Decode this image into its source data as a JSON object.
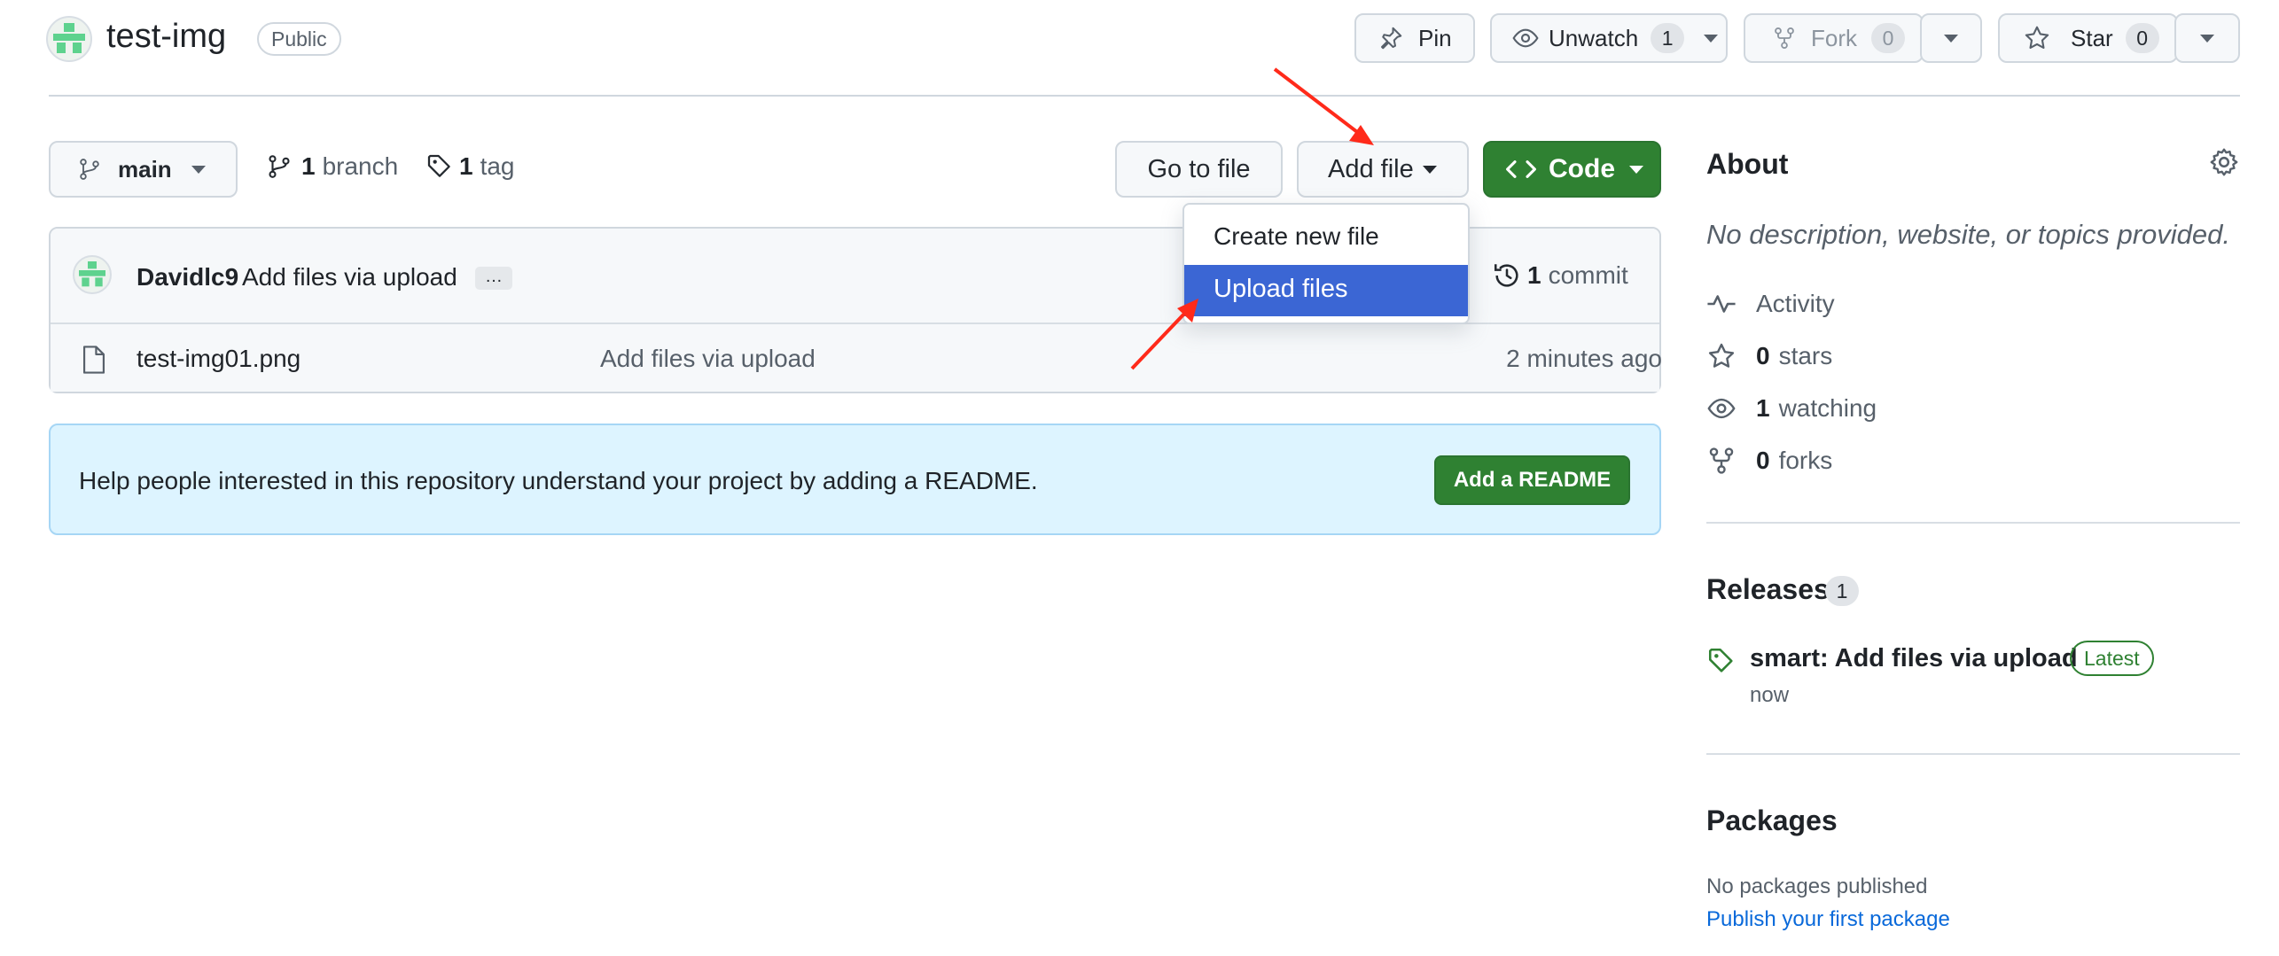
{
  "repo": {
    "name": "test-img",
    "visibility": "Public"
  },
  "header_actions": {
    "pin_label": "Pin",
    "unwatch_label": "Unwatch",
    "unwatch_count": "1",
    "fork_label": "Fork",
    "fork_count": "0",
    "star_label": "Star",
    "star_count": "0"
  },
  "toolbar": {
    "branch_name": "main",
    "branch_count": "1",
    "branch_label": "branch",
    "tag_count": "1",
    "tag_label": "tag",
    "go_to_file_label": "Go to file",
    "add_file_label": "Add file",
    "code_label": "Code"
  },
  "add_file_menu": {
    "items": [
      {
        "label": "Create new file",
        "selected": false
      },
      {
        "label": "Upload files",
        "selected": true
      }
    ]
  },
  "commit_bar": {
    "author": "Davidlc9",
    "message": "Add files via upload",
    "ellipsis": "…",
    "commit_count": "1",
    "commit_label": "commit"
  },
  "files": [
    {
      "name": "test-img01.png",
      "commit_message": "Add files via upload",
      "age": "2 minutes ago"
    }
  ],
  "readme_banner": {
    "text": "Help people interested in this repository understand your project by adding a README.",
    "button_label": "Add a README"
  },
  "about": {
    "title": "About",
    "description": "No description, website, or topics provided.",
    "activity_label": "Activity",
    "stars_count": "0",
    "stars_label": "stars",
    "watching_count": "1",
    "watching_label": "watching",
    "forks_count": "0",
    "forks_label": "forks"
  },
  "releases": {
    "title": "Releases",
    "count": "1",
    "latest_name": "smart: Add files via upload",
    "latest_badge": "Latest",
    "latest_time": "now"
  },
  "packages": {
    "title": "Packages",
    "empty_text": "No packages published",
    "publish_link": "Publish your first package"
  },
  "colors": {
    "accent_blue": "#0969da",
    "selected_item": "#3b66d4",
    "primary_green": "#2f8132",
    "readme_bg": "#ddf4ff",
    "annotation_red": "#ff2a1a"
  },
  "icons": [
    "repo-identicon",
    "pin-icon",
    "eye-icon",
    "fork-icon",
    "star-icon",
    "branch-icon",
    "tag-icon",
    "code-icon",
    "history-icon",
    "file-icon",
    "gear-icon",
    "pulse-icon"
  ]
}
